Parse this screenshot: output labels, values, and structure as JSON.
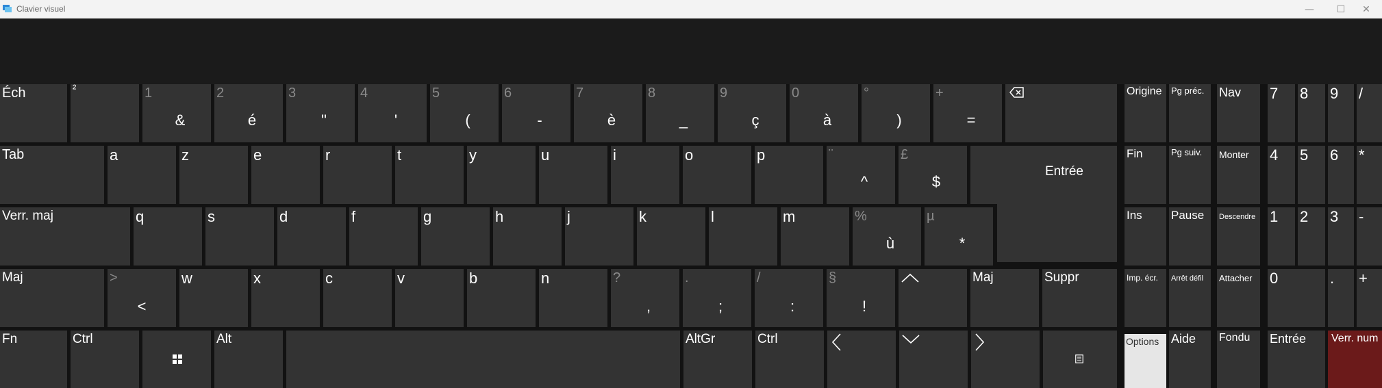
{
  "window": {
    "title": "Clavier visuel",
    "minimize_glyph": "—",
    "maximize_glyph": "☐",
    "close_glyph": "✕"
  },
  "rows": {
    "row1": [
      {
        "name": "key-esc",
        "top": "Éch"
      },
      {
        "name": "key-superscript-2",
        "top": "²"
      },
      {
        "name": "key-1",
        "top": "1",
        "bottom": "&"
      },
      {
        "name": "key-2",
        "top": "2",
        "bottom": "é"
      },
      {
        "name": "key-3",
        "top": "3",
        "bottom": "\""
      },
      {
        "name": "key-4",
        "top": "4",
        "bottom": "'"
      },
      {
        "name": "key-5",
        "top": "5",
        "bottom": "("
      },
      {
        "name": "key-6",
        "top": "6",
        "bottom": "-"
      },
      {
        "name": "key-7",
        "top": "7",
        "bottom": "è"
      },
      {
        "name": "key-8",
        "top": "8",
        "bottom": "_"
      },
      {
        "name": "key-9",
        "top": "9",
        "bottom": "ç"
      },
      {
        "name": "key-0",
        "top": "0",
        "bottom": "à"
      },
      {
        "name": "key-degree",
        "top": "°",
        "bottom": ")"
      },
      {
        "name": "key-plus",
        "top": "+",
        "bottom": "="
      }
    ],
    "row2": [
      {
        "name": "key-tab",
        "top": "Tab"
      },
      {
        "name": "key-a",
        "top": "a"
      },
      {
        "name": "key-z",
        "top": "z"
      },
      {
        "name": "key-e",
        "top": "e"
      },
      {
        "name": "key-r",
        "top": "r"
      },
      {
        "name": "key-t",
        "top": "t"
      },
      {
        "name": "key-y",
        "top": "y"
      },
      {
        "name": "key-u",
        "top": "u"
      },
      {
        "name": "key-i",
        "top": "i"
      },
      {
        "name": "key-o",
        "top": "o"
      },
      {
        "name": "key-p",
        "top": "p"
      },
      {
        "name": "key-caret",
        "top": "¨",
        "bottom": "^"
      },
      {
        "name": "key-dollar",
        "top": "£",
        "bottom": "$"
      }
    ],
    "enter_label": "Entrée",
    "row3": [
      {
        "name": "key-caps-lock",
        "top": "Verr. maj"
      },
      {
        "name": "key-q",
        "top": "q"
      },
      {
        "name": "key-s",
        "top": "s"
      },
      {
        "name": "key-d",
        "top": "d"
      },
      {
        "name": "key-f",
        "top": "f"
      },
      {
        "name": "key-g",
        "top": "g"
      },
      {
        "name": "key-h",
        "top": "h"
      },
      {
        "name": "key-j",
        "top": "j"
      },
      {
        "name": "key-k",
        "top": "k"
      },
      {
        "name": "key-l",
        "top": "l"
      },
      {
        "name": "key-m",
        "top": "m"
      },
      {
        "name": "key-u-grave",
        "top": "%",
        "bottom": "ù"
      },
      {
        "name": "key-asterisk",
        "top": "µ",
        "bottom": "*"
      }
    ],
    "row4": [
      {
        "name": "key-shift-left",
        "top": "Maj"
      },
      {
        "name": "key-less-than",
        "top": ">",
        "bottom": "<"
      },
      {
        "name": "key-w",
        "top": "w"
      },
      {
        "name": "key-x",
        "top": "x"
      },
      {
        "name": "key-c",
        "top": "c"
      },
      {
        "name": "key-v",
        "top": "v"
      },
      {
        "name": "key-b",
        "top": "b"
      },
      {
        "name": "key-n",
        "top": "n"
      },
      {
        "name": "key-comma",
        "top": "?",
        "bottom": ","
      },
      {
        "name": "key-semicolon",
        "top": ".",
        "bottom": ";"
      },
      {
        "name": "key-colon",
        "top": "/",
        "bottom": ":"
      },
      {
        "name": "key-exclamation",
        "top": "§",
        "bottom": "!"
      }
    ],
    "shift_right": "Maj",
    "suppr": "Suppr",
    "row5": {
      "fn": "Fn",
      "ctrl_left": "Ctrl",
      "alt": "Alt",
      "altgr": "AltGr",
      "ctrl_right": "Ctrl"
    }
  },
  "nav": {
    "origine": "Origine",
    "pg_prec": "Pg préc.",
    "nav": "Nav",
    "fin": "Fin",
    "pg_suiv": "Pg suiv.",
    "monter": "Monter",
    "ins": "Ins",
    "pause": "Pause",
    "descendre": "Descendre",
    "imp_ecr": "Imp. écr.",
    "arret_defil": "Arrêt défil",
    "attacher": "Attacher",
    "options": "Options",
    "aide": "Aide",
    "fondu": "Fondu"
  },
  "numpad": {
    "n7": "7",
    "n8": "8",
    "n9": "9",
    "div": "/",
    "n4": "4",
    "n5": "5",
    "n6": "6",
    "mul": "*",
    "n1": "1",
    "n2": "2",
    "n3": "3",
    "minus": "-",
    "n0": "0",
    "dot": ".",
    "plus": "+",
    "entree": "Entrée",
    "verr_num": "Verr. num"
  },
  "colors": {
    "key_bg": "#333333",
    "keyboard_bg": "#121212",
    "options_bg": "#e6e6e6",
    "numlock_bg": "#6b1a1a"
  }
}
